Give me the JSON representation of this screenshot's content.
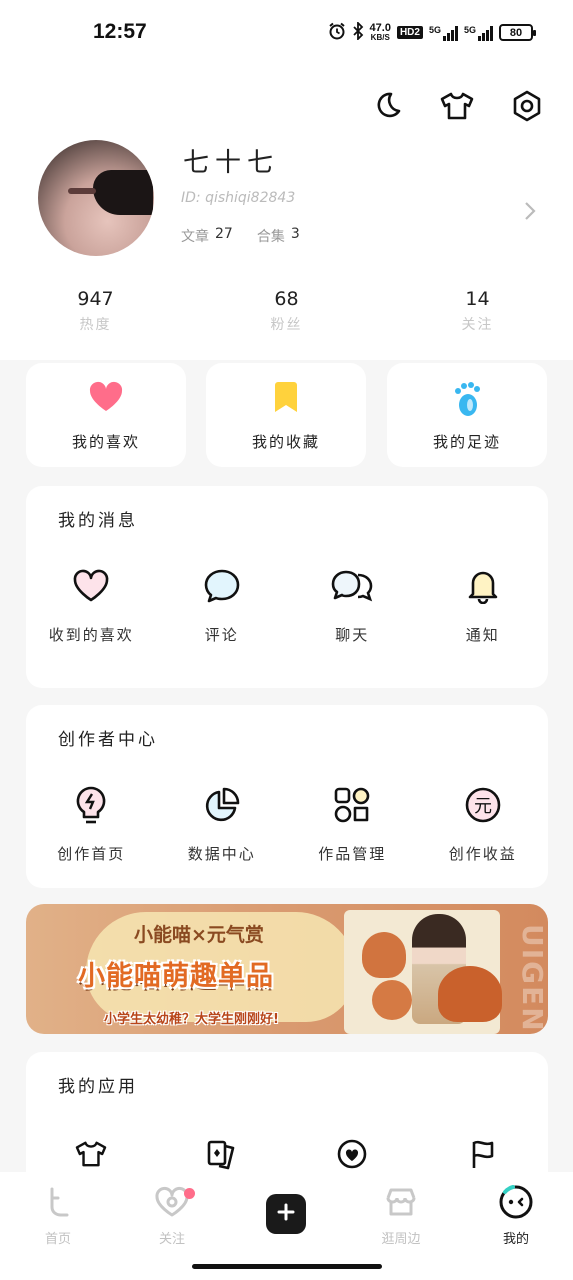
{
  "status_bar": {
    "time": "12:57",
    "net_speed_value": "47.0",
    "net_speed_unit": "KB/S",
    "hd": "HD2",
    "sig1": "5G",
    "sig2": "5G",
    "battery": "80",
    "icons": [
      "alarm-icon",
      "bluetooth-icon"
    ]
  },
  "profile": {
    "username": "七十七",
    "user_id": "ID: qishiqi82843",
    "articles_label": "文章",
    "articles_count": "27",
    "collections_label": "合集",
    "collections_count": "3"
  },
  "stats": [
    {
      "value": "947",
      "label": "热度"
    },
    {
      "value": "68",
      "label": "粉丝"
    },
    {
      "value": "14",
      "label": "关注"
    }
  ],
  "quick_links": [
    {
      "label": "我的喜欢",
      "icon": "heart-icon",
      "color": "#ff6d8a"
    },
    {
      "label": "我的收藏",
      "icon": "bookmark-icon",
      "color": "#ffd23c"
    },
    {
      "label": "我的足迹",
      "icon": "footprint-icon",
      "color": "#39b7f0"
    }
  ],
  "messages": {
    "title": "我的消息",
    "items": [
      {
        "label": "收到的喜欢",
        "icon": "heart-outline-icon"
      },
      {
        "label": "评论",
        "icon": "comment-icon"
      },
      {
        "label": "聊天",
        "icon": "chat-icon"
      },
      {
        "label": "通知",
        "icon": "bell-icon"
      }
    ]
  },
  "creator": {
    "title": "创作者中心",
    "items": [
      {
        "label": "创作首页",
        "icon": "bulb-icon"
      },
      {
        "label": "数据中心",
        "icon": "pie-chart-icon"
      },
      {
        "label": "作品管理",
        "icon": "shapes-icon"
      },
      {
        "label": "创作收益",
        "icon": "yuan-icon"
      }
    ]
  },
  "banner": {
    "top": "小能喵×元气赏",
    "main": "小能喵萌趣单品",
    "sub": "小学生太幼稚？大学生刚刚好!",
    "side": "UIGEN"
  },
  "apps": {
    "title": "我的应用",
    "icons": [
      "tshirt-icon",
      "cards-icon",
      "badge-icon",
      "flag-icon"
    ]
  },
  "nav": [
    {
      "label": "首页",
      "icon": "home-icon"
    },
    {
      "label": "关注",
      "icon": "follow-icon"
    },
    {
      "label": "",
      "icon": "plus-icon"
    },
    {
      "label": "逛周边",
      "icon": "shop-icon"
    },
    {
      "label": "我的",
      "icon": "me-icon"
    }
  ],
  "colors": {
    "accent_pink": "#ff6d8a",
    "accent_yellow": "#ffd23c",
    "accent_blue": "#39b7f0"
  }
}
